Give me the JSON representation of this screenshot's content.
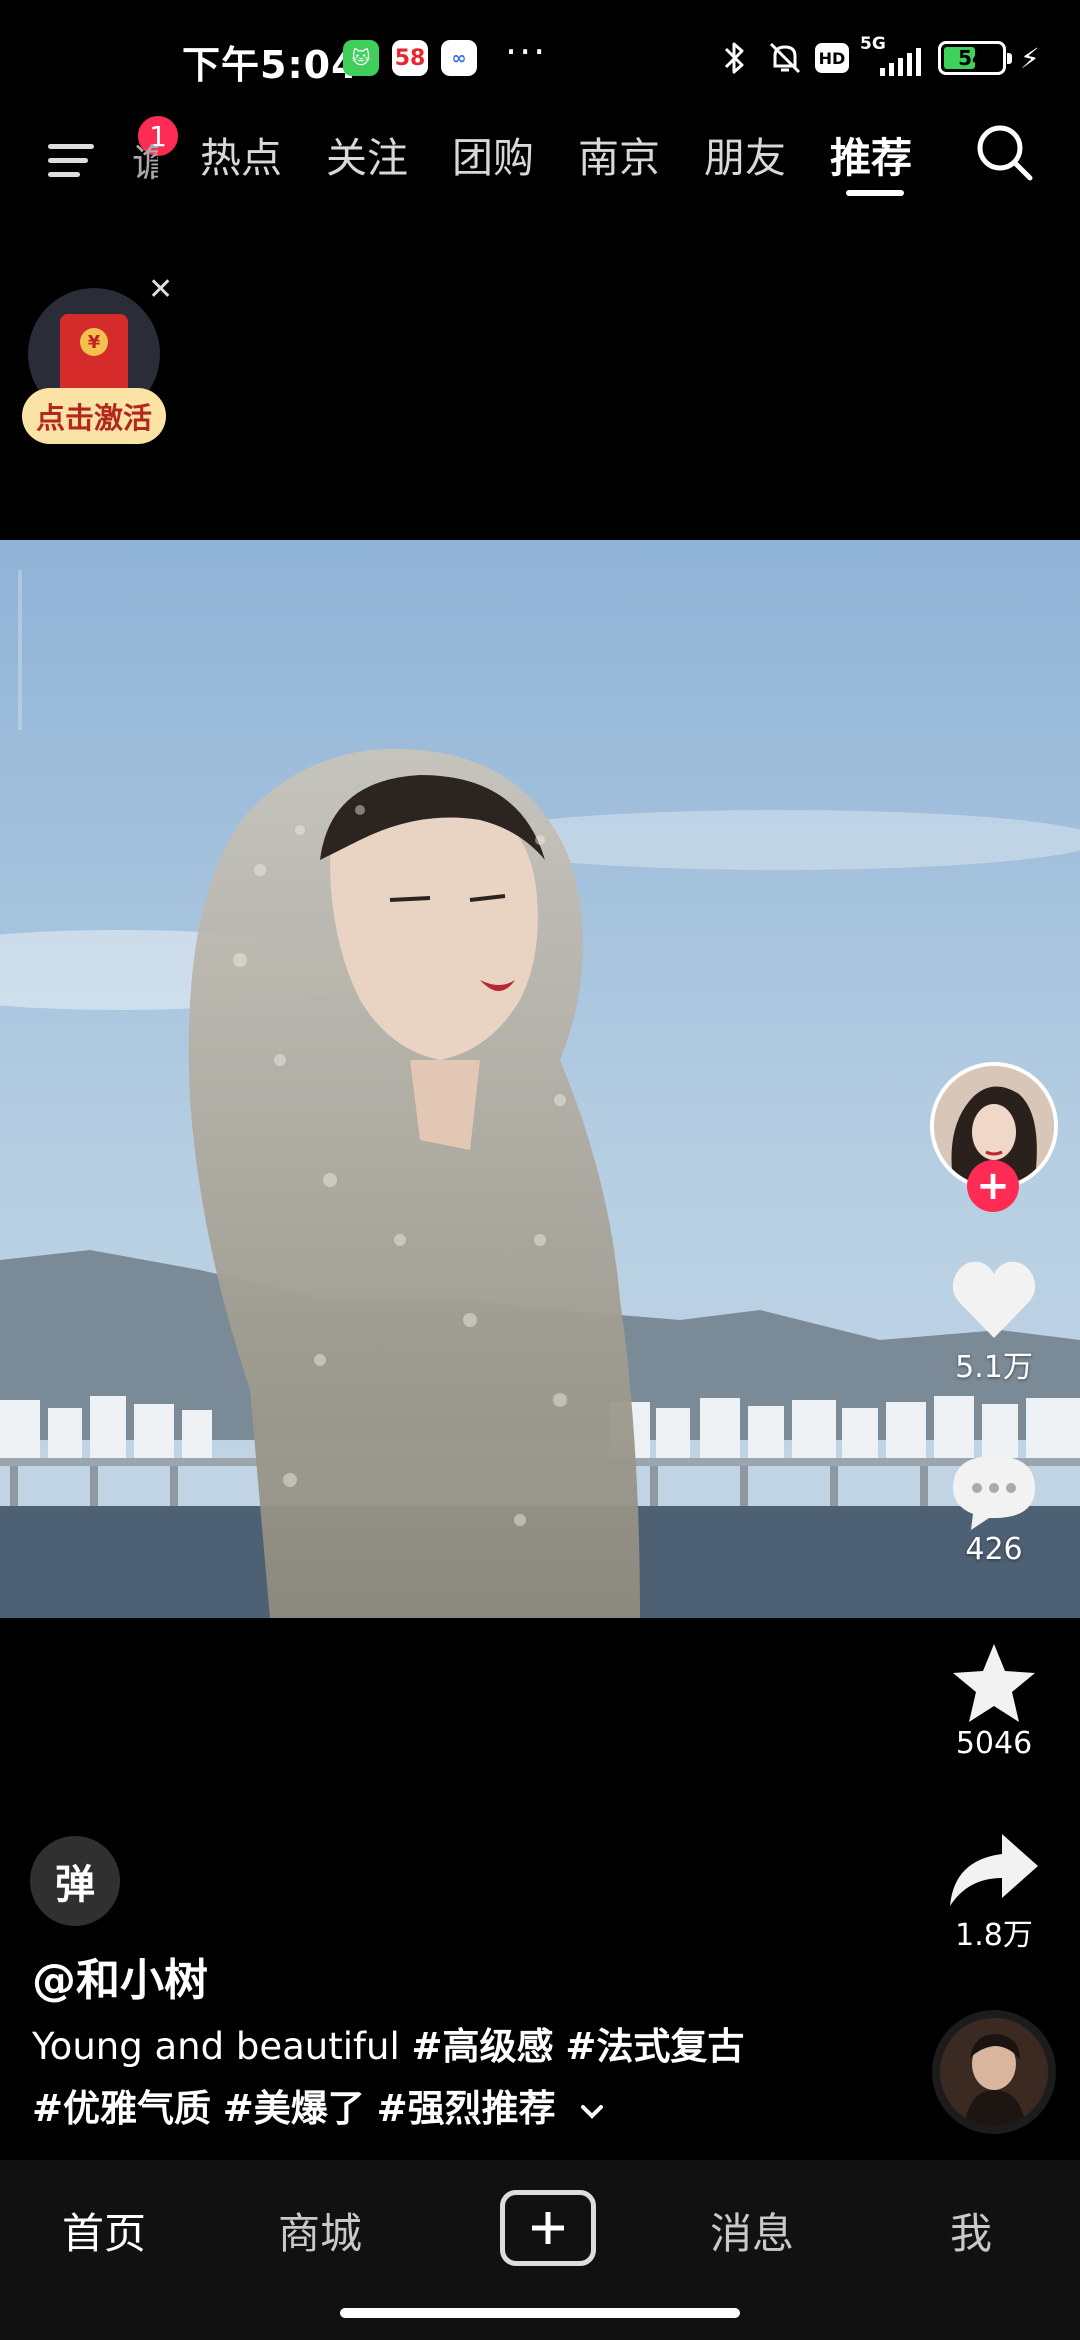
{
  "status_bar": {
    "time": "下午5:04",
    "app1_glyph": "🐱",
    "app2_glyph": "58",
    "app3_glyph": "∞",
    "more": "···",
    "network": "5G",
    "battery": "54"
  },
  "top_nav": {
    "menu_badge": "1",
    "partial_tab": "谵",
    "tabs": [
      {
        "label": "热点"
      },
      {
        "label": "关注"
      },
      {
        "label": "团购"
      },
      {
        "label": "南京"
      },
      {
        "label": "朋友"
      },
      {
        "label": "推荐",
        "active": true
      }
    ]
  },
  "red_packet": {
    "label": "点击激活",
    "coin": "¥"
  },
  "actions": {
    "likes": "5.1万",
    "comments": "426",
    "favorites": "5046",
    "shares": "1.8万"
  },
  "video_info": {
    "danmu": "弹",
    "username": "@和小树",
    "caption_text": "Young and beautiful",
    "tags": [
      "#高级感",
      "#法式复古",
      "#优雅气质",
      "#美爆了",
      "#强烈推荐"
    ]
  },
  "tabbar": {
    "home": "首页",
    "mall": "商城",
    "messages": "消息",
    "me": "我"
  },
  "colors": {
    "accent": "#fe2c55",
    "sky": "#a9c4dc",
    "background": "#000000"
  }
}
